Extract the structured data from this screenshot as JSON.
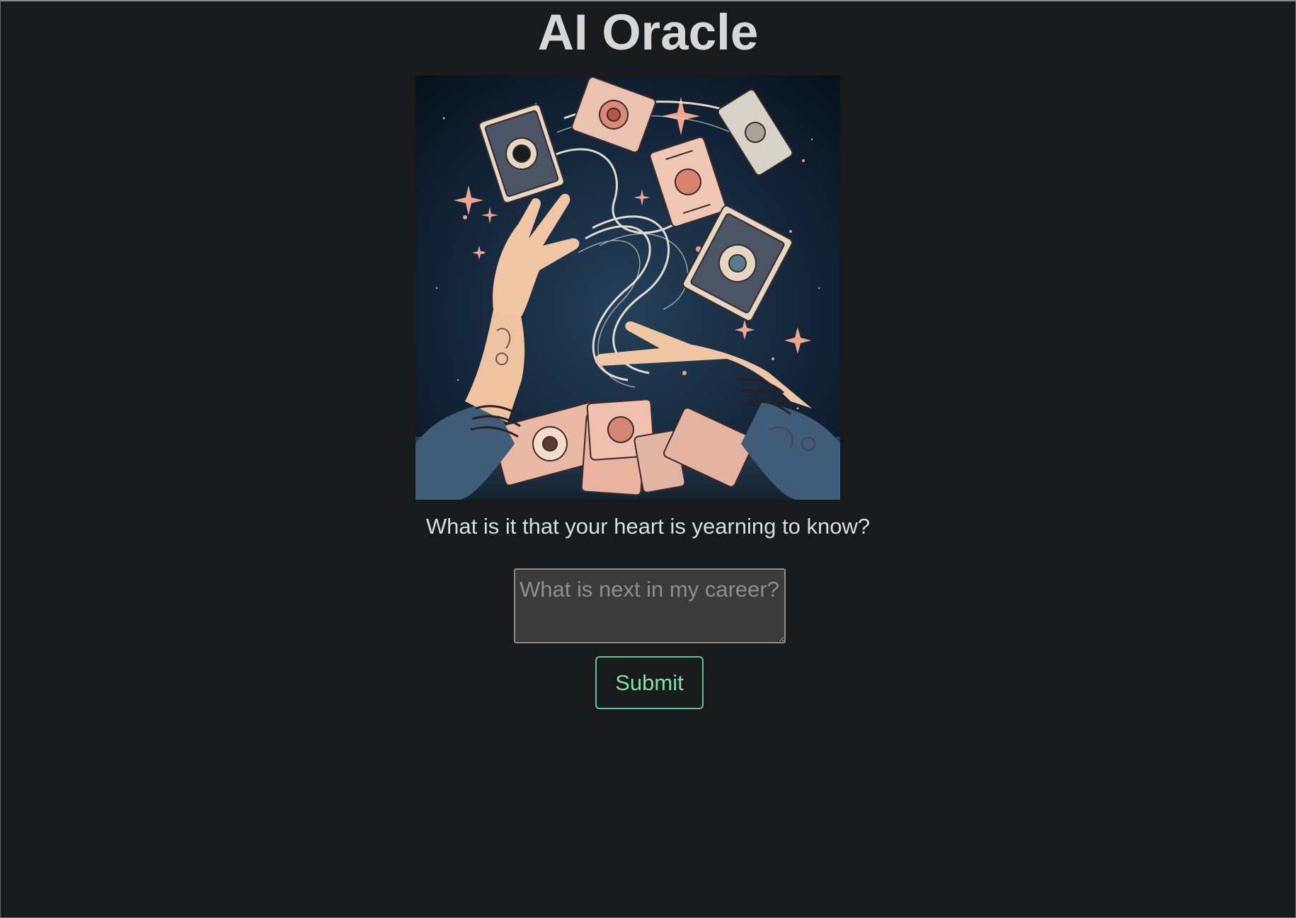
{
  "header": {
    "title": "AI Oracle"
  },
  "hero_image": {
    "icon": "tarot-hands-illustration",
    "colors": {
      "background": "#0f1a28",
      "card": "#e9b9a6",
      "skin": "#efc2a0",
      "sparkle": "#f0a58f",
      "swirl": "#f3eedb"
    }
  },
  "main": {
    "prompt": "What is it that your heart is yearning to know?",
    "question": {
      "value": "",
      "placeholder": "What is next in my career?"
    },
    "submit_label": "Submit"
  },
  "theme": {
    "background": "#191a1b",
    "accent": "#56c98f"
  }
}
